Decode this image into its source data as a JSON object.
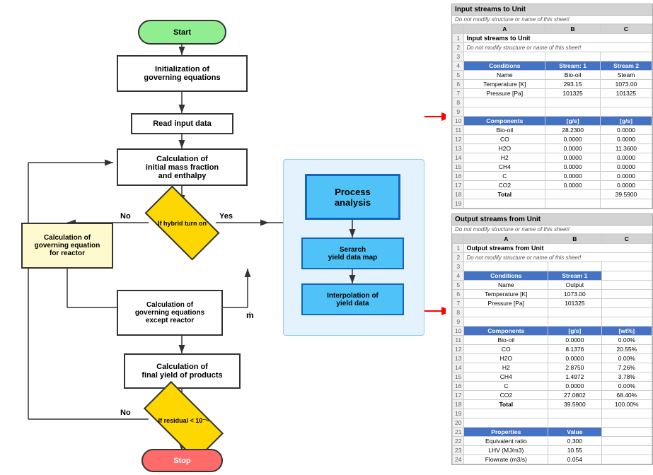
{
  "flowchart": {
    "start_label": "Start",
    "stop_label": "Stop",
    "init_label": "Initialization of\ngoverning equations",
    "read_label": "Read input data",
    "calc_mass_label": "Calculation of\ninitial mass fraction\nand enthalpy",
    "hybrid_label": "If hybrid turn on",
    "governing_eq_label": "Calculation of\ngoverning equation\nfor reactor",
    "governing_except_label": "Calculation of\ngoverning equations\nexcept reactor",
    "final_yield_label": "Calculation of\nfinal yield of products",
    "residual_label": "If residual < 10⁻⁵",
    "process_analysis_label": "Process\nanalysis",
    "search_yield_label": "Serarch\nyield data map",
    "interp_label": "Interpolation of\nyield data",
    "no_label": "No",
    "yes_label": "Yes",
    "m_label": "ṁ"
  },
  "sheet1": {
    "title": "Input streams to Unit",
    "subtitle": "Do not modify structure or name of this sheet!",
    "col_headers": [
      "",
      "A",
      "B",
      "C"
    ],
    "row2_label": "",
    "conditions_label": "Conditions",
    "stream1_label": "Stream: 1",
    "stream2_label": "Stream 2",
    "name_label": "Name",
    "bio_oil_label": "Bio-oil",
    "steam_label": "Steam",
    "temp_label": "Temperature [K]",
    "temp1_val": "293.15",
    "temp2_val": "1073.00",
    "pressure_label": "Pressure [Pa]",
    "press1_val": "101325",
    "press2_val": "101325",
    "components_label": "Components",
    "unit1_label": "[g/s]",
    "unit2_label": "[g/s]",
    "components": [
      {
        "name": "Bio-oil",
        "s1": "28.2300",
        "s2": "0.0000"
      },
      {
        "name": "CO",
        "s1": "0.0000",
        "s2": "0.0000"
      },
      {
        "name": "H2O",
        "s1": "0.0000",
        "s2": "11.3600"
      },
      {
        "name": "H2",
        "s1": "0.0000",
        "s2": "0.0000"
      },
      {
        "name": "CH4",
        "s1": "0.0000",
        "s2": "0.0000"
      },
      {
        "name": "C",
        "s1": "0.0000",
        "s2": "0.0000"
      },
      {
        "name": "CO2",
        "s1": "0.0000",
        "s2": "0.0000"
      },
      {
        "name": "Total",
        "s1": "",
        "s2": "39.5900"
      }
    ],
    "row_numbers": [
      "1",
      "2",
      "3",
      "4",
      "5",
      "6",
      "7",
      "8",
      "9",
      "10",
      "11",
      "12",
      "13",
      "14",
      "15",
      "16",
      "17",
      "18",
      "19"
    ]
  },
  "sheet2": {
    "title": "Output streams from Unit",
    "subtitle": "Do not modify structure or name of this sheet!",
    "conditions_label": "Conditions",
    "stream1_label": "Stream 1",
    "name_label": "Name",
    "output_label": "Output",
    "temp_label": "Temperature [K]",
    "temp_val": "1073.00",
    "pressure_label": "Pressure [Pa]",
    "press_val": "101325",
    "components_label": "Components",
    "unit1_label": "[g/s]",
    "unit2_label": "[wt%]",
    "components": [
      {
        "name": "Bio-oil",
        "s1": "0.0000",
        "pct": "0.00%"
      },
      {
        "name": "CO",
        "s1": "8.1376",
        "pct": "20.55%"
      },
      {
        "name": "H2O",
        "s1": "0.0000",
        "pct": "0.00%"
      },
      {
        "name": "H2",
        "s1": "2.8750",
        "pct": "7.26%"
      },
      {
        "name": "CH4",
        "s1": "1.4972",
        "pct": "3.78%"
      },
      {
        "name": "C",
        "s1": "0.0000",
        "pct": "0.00%"
      },
      {
        "name": "CO2",
        "s1": "27.0802",
        "pct": "68.40%"
      },
      {
        "name": "Total",
        "s1": "39.5900",
        "pct": "100.00%"
      }
    ],
    "props_label": "Properties",
    "value_label": "Value",
    "properties": [
      {
        "name": "Equivalent ratio",
        "val": "0.300"
      },
      {
        "name": "LHV\n(MJ/m3)",
        "val": "10.55"
      },
      {
        "name": "Flowrate\n(m3/s)",
        "val": "0.054"
      }
    ]
  }
}
